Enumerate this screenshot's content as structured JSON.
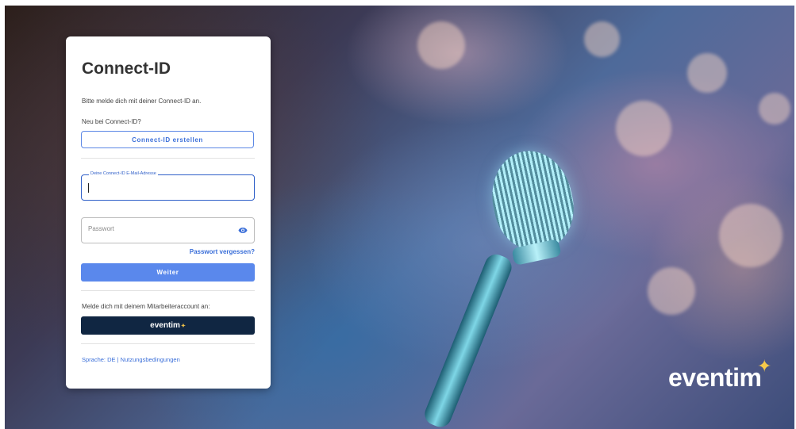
{
  "login": {
    "title": "Connect-ID",
    "intro": "Bitte melde dich mit deiner Connect-ID an.",
    "new_prompt": "Neu bei Connect-ID?",
    "create_button": "Connect-ID erstellen",
    "email_label": "Deine Connect-ID E-Mail-Adresse",
    "email_value": "",
    "password_placeholder": "Passwort",
    "forgot_link": "Passwort vergessen?",
    "submit_button": "Weiter",
    "employee_prompt": "Melde dich mit deinem Mitarbeiteraccount an:",
    "employee_button": "eventim",
    "language_link": "Sprache: DE",
    "separator": "|",
    "terms_link": "Nutzungsbedingungen"
  },
  "brand": {
    "logo_text": "eventim",
    "accent_color": "#f6c949",
    "primary_color": "#5a88ec",
    "dark_color": "#102642"
  },
  "icons": {
    "eye": "eye-icon",
    "star": "sparkle-star-icon"
  }
}
